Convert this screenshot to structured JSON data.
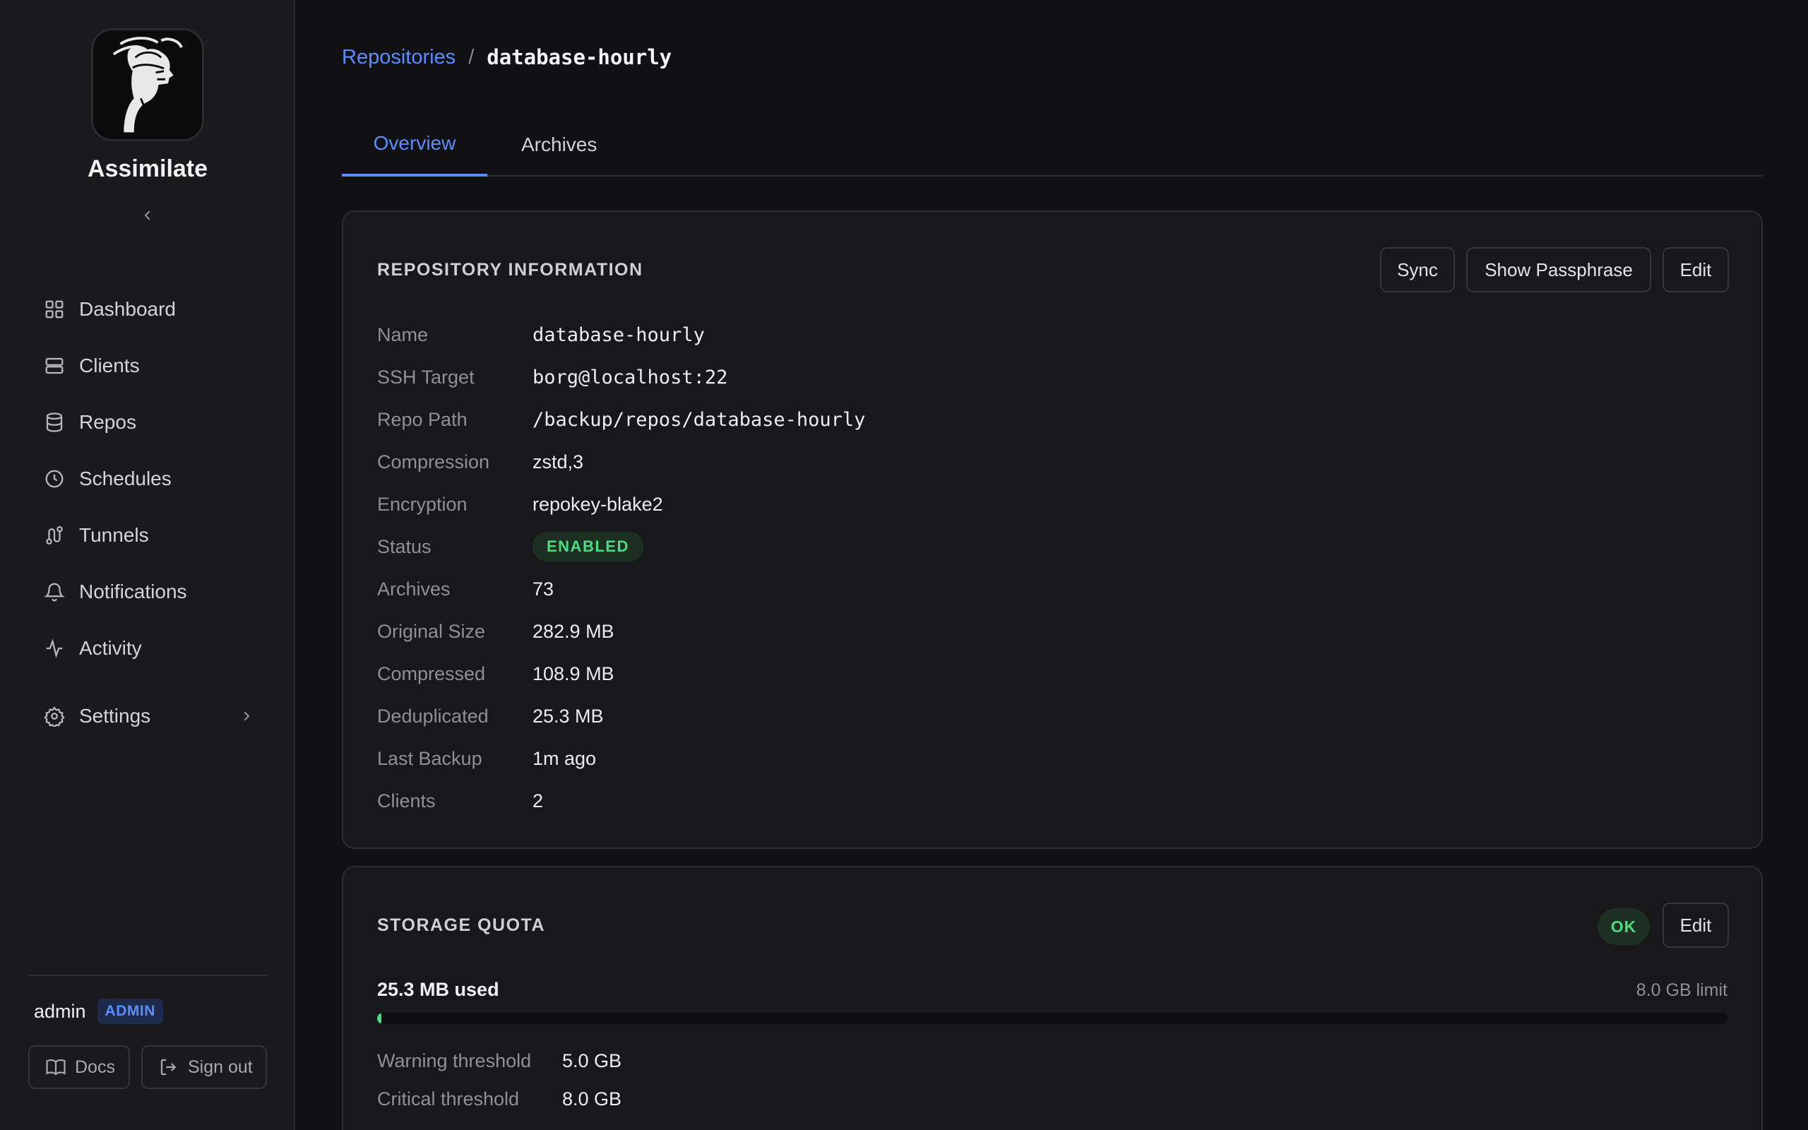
{
  "app": {
    "name": "Assimilate"
  },
  "sidebar": {
    "items": [
      {
        "label": "Dashboard",
        "icon": "grid-icon"
      },
      {
        "label": "Clients",
        "icon": "server-icon"
      },
      {
        "label": "Repos",
        "icon": "database-icon"
      },
      {
        "label": "Schedules",
        "icon": "clock-icon"
      },
      {
        "label": "Tunnels",
        "icon": "route-icon"
      },
      {
        "label": "Notifications",
        "icon": "bell-icon"
      },
      {
        "label": "Activity",
        "icon": "activity-icon"
      }
    ],
    "settings_label": "Settings",
    "user": {
      "name": "admin",
      "role": "ADMIN"
    },
    "docs_label": "Docs",
    "signout_label": "Sign out"
  },
  "breadcrumb": {
    "parent": "Repositories",
    "separator": "/",
    "current": "database-hourly"
  },
  "tabs": [
    {
      "label": "Overview",
      "active": true
    },
    {
      "label": "Archives",
      "active": false
    }
  ],
  "repo_info": {
    "title": "REPOSITORY INFORMATION",
    "buttons": {
      "sync": "Sync",
      "show_passphrase": "Show Passphrase",
      "edit": "Edit"
    },
    "fields": {
      "name": {
        "label": "Name",
        "value": "database-hourly"
      },
      "ssh_target": {
        "label": "SSH Target",
        "value": "borg@localhost:22"
      },
      "repo_path": {
        "label": "Repo Path",
        "value": "/backup/repos/database-hourly"
      },
      "compression": {
        "label": "Compression",
        "value": "zstd,3"
      },
      "encryption": {
        "label": "Encryption",
        "value": "repokey-blake2"
      },
      "status": {
        "label": "Status",
        "value": "ENABLED"
      },
      "archives": {
        "label": "Archives",
        "value": "73"
      },
      "original_size": {
        "label": "Original Size",
        "value": "282.9 MB"
      },
      "compressed": {
        "label": "Compressed",
        "value": "108.9 MB"
      },
      "deduplicated": {
        "label": "Deduplicated",
        "value": "25.3 MB"
      },
      "last_backup": {
        "label": "Last Backup",
        "value": "1m ago"
      },
      "clients": {
        "label": "Clients",
        "value": "2"
      }
    }
  },
  "storage_quota": {
    "title": "STORAGE QUOTA",
    "status": "OK",
    "edit_label": "Edit",
    "used": "25.3 MB used",
    "limit": "8.0 GB limit",
    "usage_fraction": 0.003,
    "warning": {
      "label": "Warning threshold",
      "value": "5.0 GB"
    },
    "critical": {
      "label": "Critical threshold",
      "value": "8.0 GB"
    }
  },
  "colors": {
    "accent": "#5b8dff",
    "ok": "#4ade80",
    "background": "#111114"
  }
}
